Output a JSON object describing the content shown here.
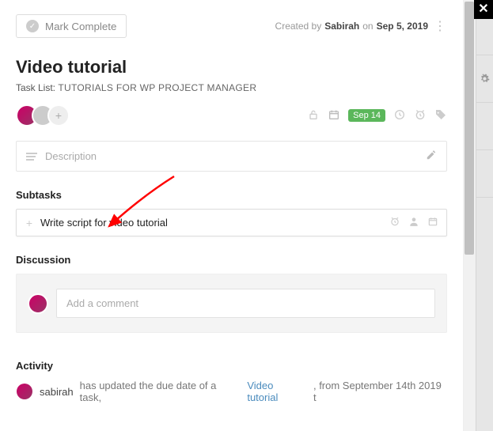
{
  "close_label": "✕",
  "mark_complete": "Mark Complete",
  "created": {
    "prefix": "Created by",
    "user": "Sabirah",
    "on": "on",
    "date": "Sep 5, 2019"
  },
  "title": "Video tutorial",
  "tasklist": {
    "label": "Task List:",
    "name": "TUTORIALS FOR WP PROJECT MANAGER"
  },
  "due_pill": "Sep 14",
  "description_placeholder": "Description",
  "sections": {
    "subtasks": "Subtasks",
    "discussion": "Discussion",
    "activity": "Activity"
  },
  "subtask_input_value": "Write script for video tutorial",
  "comment_placeholder": "Add a comment",
  "activity": {
    "user": "sabirah",
    "text1": "has updated the due date of a task,",
    "link": "Video tutorial",
    "text2": ", from September 14th 2019 t"
  },
  "colors": {
    "accent_green": "#5bb75b",
    "link": "#4a8bbd",
    "arrow": "#ff0000"
  }
}
